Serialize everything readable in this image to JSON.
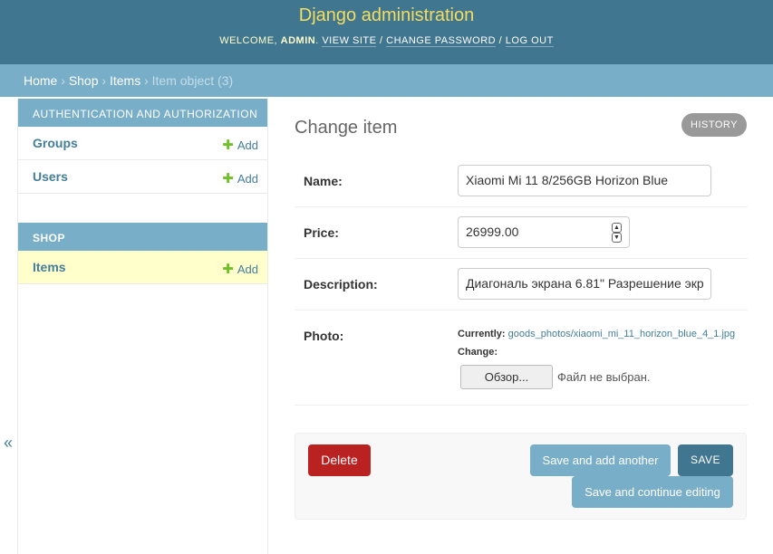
{
  "header": {
    "site_name": "Django administration",
    "welcome": "Welcome,",
    "username": "admin",
    "view_site": "View site",
    "change_password": "Change password",
    "log_out": "Log out",
    "sep": " / "
  },
  "breadcrumbs": {
    "home": "Home",
    "app": "Shop",
    "model": "Items",
    "current": "Item object (3)",
    "sep": " › "
  },
  "sidebar": {
    "auth_caption": "Authentication and Authorization",
    "groups": "Groups",
    "users": "Users",
    "shop_caption": "Shop",
    "items": "Items",
    "add_label": "Add",
    "toggle": "«"
  },
  "form": {
    "title": "Change item",
    "history": "History",
    "name_label": "Name:",
    "name_value": "Xiaomi Mi 11 8/256GB Horizon Blue",
    "price_label": "Price:",
    "price_value": "26999.00",
    "description_label": "Description:",
    "description_value": "Диагональ экрана 6.81\" Разрешение экр",
    "photo_label": "Photo:",
    "currently_label": "Currently:",
    "current_file": "goods_photos/xiaomi_mi_11_horizon_blue_4_1.jpg",
    "change_label": "Change:",
    "browse_button": "Обзор...",
    "no_file": "Файл не выбран."
  },
  "submit": {
    "delete": "Delete",
    "save_add_another": "Save and add another",
    "save": "Save",
    "save_continue": "Save and continue editing"
  },
  "colors": {
    "header_bg": "#417690",
    "breadcrumbs_bg": "#79aec8",
    "brand_text": "#f5dd5d",
    "link": "#447e9b",
    "delete_bg": "#ba2121",
    "current_row_bg": "#ffffcc"
  },
  "icons": {
    "add": "plus-icon",
    "spinner_up": "chevron-up-icon",
    "spinner_down": "chevron-down-icon",
    "toggle": "double-chevron-left-icon"
  }
}
